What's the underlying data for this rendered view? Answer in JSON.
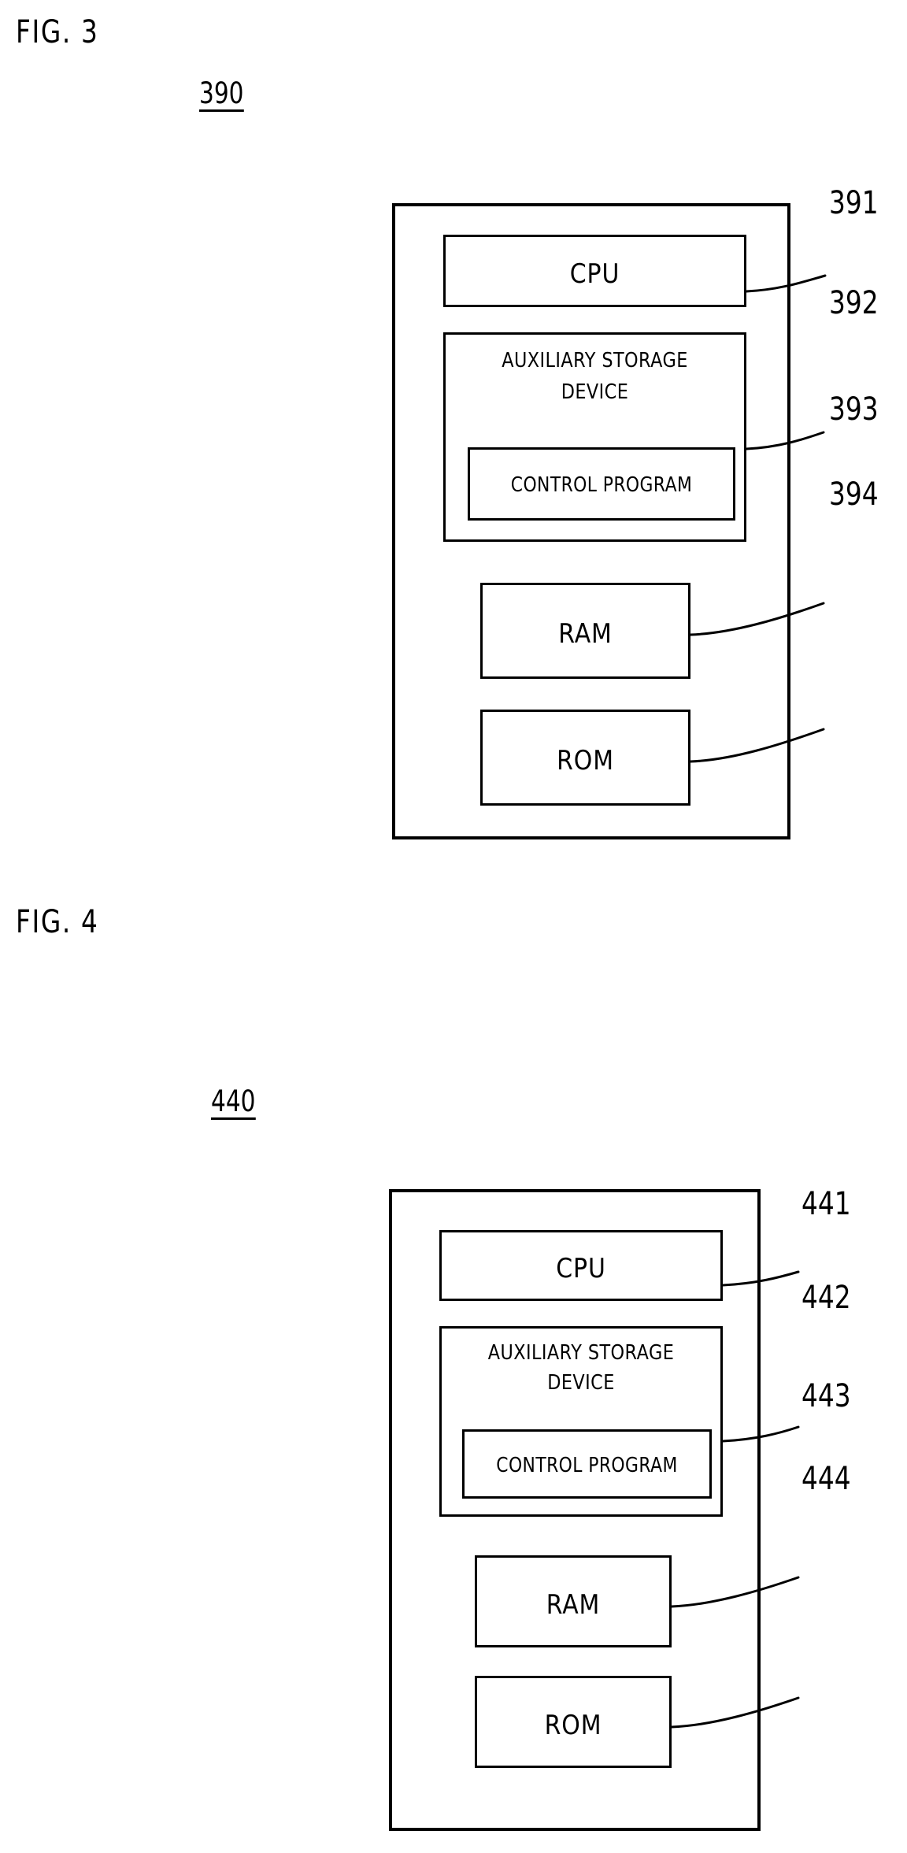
{
  "document": {
    "type": "patent-drawing-sheet",
    "background_color": "#ffffff",
    "ink_color": "#000000"
  },
  "figures": [
    {
      "caption": "FIG. 3",
      "reference_numeral": "390",
      "blocks": [
        {
          "label": "CPU",
          "callout": "391"
        },
        {
          "label_line1": "AUXILIARY STORAGE",
          "label_line2": "DEVICE",
          "callout": "392",
          "child": {
            "label": "CONTROL PROGRAM"
          }
        },
        {
          "label": "RAM",
          "callout": "393"
        },
        {
          "label": "ROM",
          "callout": "394"
        }
      ]
    },
    {
      "caption": "FIG. 4",
      "reference_numeral": "440",
      "blocks": [
        {
          "label": "CPU",
          "callout": "441"
        },
        {
          "label_line1": "AUXILIARY STORAGE",
          "label_line2": "DEVICE",
          "callout": "442",
          "child": {
            "label": "CONTROL PROGRAM"
          }
        },
        {
          "label": "RAM",
          "callout": "443"
        },
        {
          "label": "ROM",
          "callout": "444"
        }
      ]
    }
  ],
  "fig3": {
    "caption": "FIG. 3",
    "ref": "390",
    "cpu": {
      "label": "CPU",
      "callout": "391"
    },
    "aux": {
      "line1": "AUXILIARY STORAGE",
      "line2": "DEVICE",
      "callout": "392"
    },
    "control_program": {
      "label": "CONTROL PROGRAM"
    },
    "ram": {
      "label": "RAM",
      "callout": "393"
    },
    "rom": {
      "label": "ROM",
      "callout": "394"
    }
  },
  "fig4": {
    "caption": "FIG. 4",
    "ref": "440",
    "cpu": {
      "label": "CPU",
      "callout": "441"
    },
    "aux": {
      "line1": "AUXILIARY STORAGE",
      "line2": "DEVICE",
      "callout": "442"
    },
    "control_program": {
      "label": "CONTROL PROGRAM"
    },
    "ram": {
      "label": "RAM",
      "callout": "443"
    },
    "rom": {
      "label": "ROM",
      "callout": "444"
    }
  }
}
